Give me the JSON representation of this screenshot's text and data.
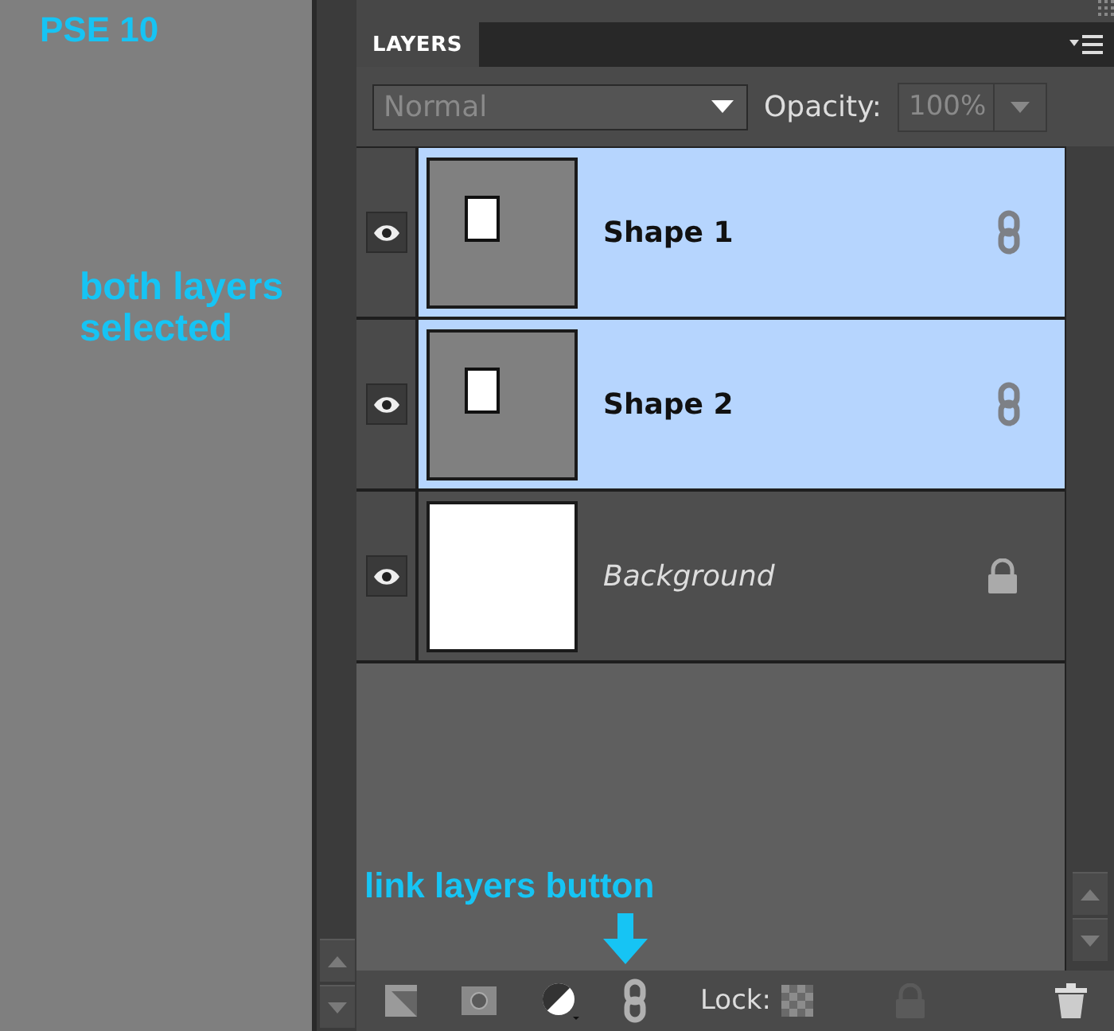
{
  "notes": [
    {
      "kind": "title",
      "text": "PSE 10"
    },
    {
      "kind": "caption",
      "text": "both layers selected"
    },
    {
      "kind": "pointer",
      "text": "link layers button"
    }
  ],
  "panel": {
    "tab": {
      "label": "LAYERS",
      "selected": true
    },
    "blend_mode": "Normal",
    "opacity_label": "Opacity:",
    "opacity": "100%",
    "layers": [
      {
        "name": "Shape 1",
        "kind": "shape",
        "selected": true,
        "visible": true,
        "linked": true,
        "locked": false
      },
      {
        "name": "Shape 2",
        "kind": "shape",
        "selected": true,
        "visible": true,
        "linked": true,
        "locked": false
      },
      {
        "name": "Background",
        "kind": "background",
        "selected": false,
        "visible": true,
        "linked": false,
        "locked": true
      }
    ],
    "lock_label": "Lock:"
  }
}
